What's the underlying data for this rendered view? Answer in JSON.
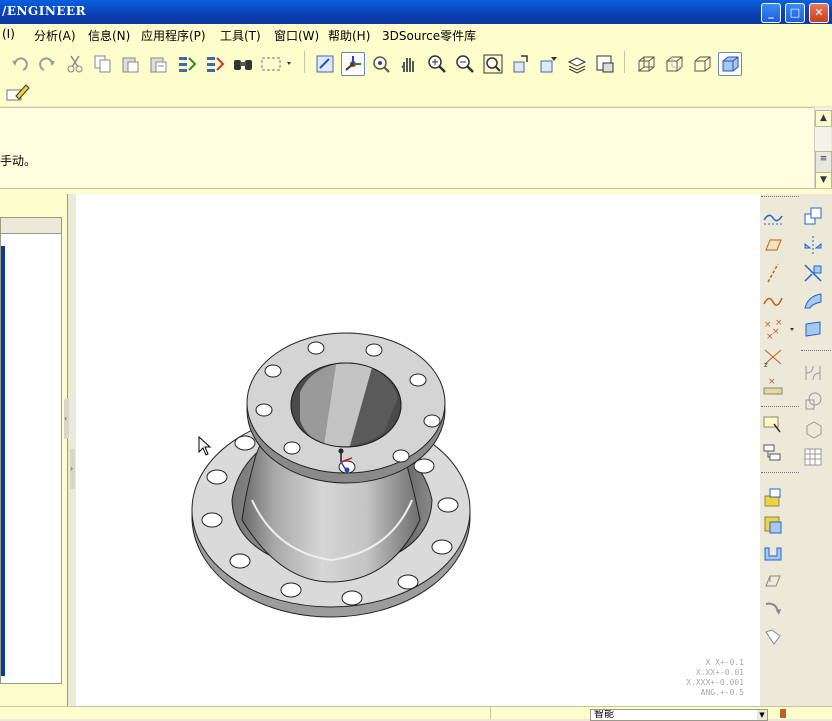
{
  "window": {
    "title": "/ENGINEER",
    "controls": [
      "minimize",
      "maximize",
      "close"
    ]
  },
  "menu": [
    "(I)",
    "分析(A)",
    "信息(N)",
    "应用程序(P)",
    "工具(T)",
    "窗口(W)",
    "帮助(H)",
    "3DSource零件库"
  ],
  "toolbar": {
    "row1": [
      "undo-icon",
      "redo-icon",
      "cut-icon",
      "copy-icon",
      "paste-icon",
      "paste-special-icon",
      "regenerate-icon",
      "regenerate-manager-icon",
      "find-icon",
      "select-box-icon",
      "repaint-icon",
      "spin-center-icon",
      "orient-mode-icon",
      "pan-icon",
      "zoom-in-icon",
      "zoom-out-icon",
      "refit-icon",
      "reorient-icon",
      "saved-views-icon",
      "layers-icon",
      "view-manager-icon",
      "wireframe-icon",
      "hidden-line-icon",
      "no-hidden-icon",
      "shading-icon"
    ],
    "row2": [
      "edit-definition-icon"
    ]
  },
  "messages": {
    "line1": "",
    "line2": "手动。"
  },
  "right_toolbar": [
    "datum-plane-icon",
    "datum-axis-icon",
    "datum-curve-icon",
    "datum-point-icon",
    "coordinate-system-icon",
    "analysis-icon",
    "extrude-icon",
    "revolve-icon",
    "sweep-icon",
    "blend-icon",
    "hole-icon",
    "shell-icon",
    "rib-icon",
    "draft-icon",
    "round-icon",
    "chamfer-icon",
    "mirror-icon",
    "merge-icon",
    "trim-icon",
    "pattern-icon"
  ],
  "tolerances": {
    "l1": "X X+-0.1",
    "l2": "X.XX+-0.01",
    "l3": "X.XXX+-0.001",
    "l4": "ANG.+-0.5"
  },
  "status": {
    "filter": "智能"
  }
}
